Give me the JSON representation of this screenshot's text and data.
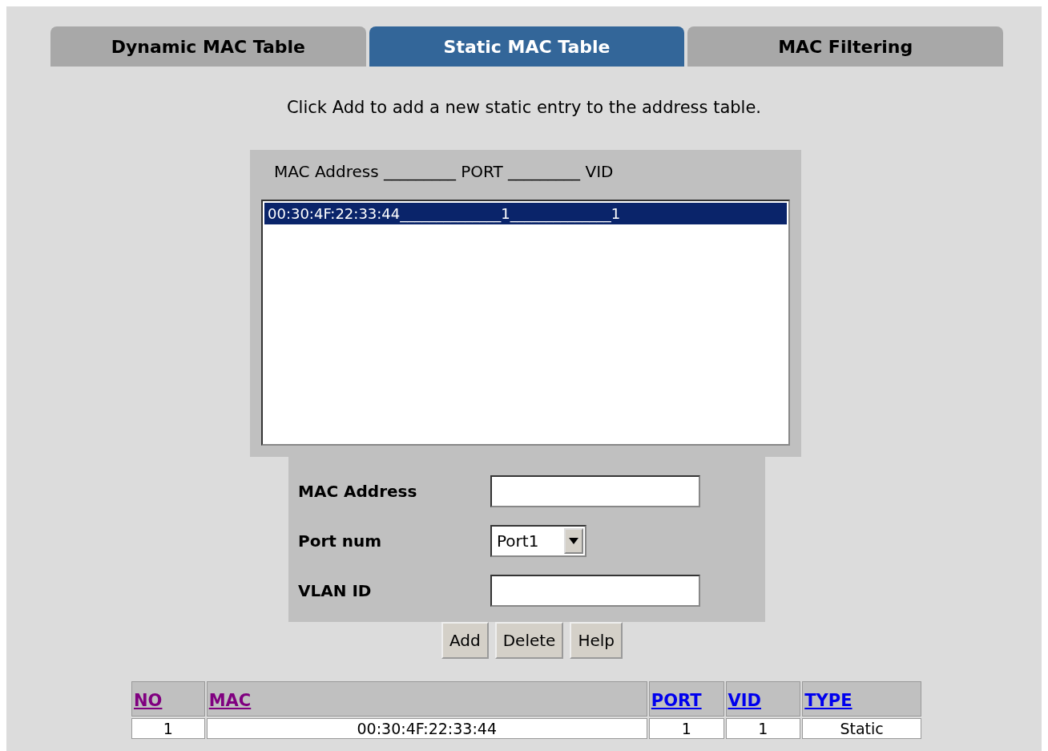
{
  "tabs": [
    {
      "label": "Dynamic MAC Table",
      "selected": false
    },
    {
      "label": "Static MAC Table",
      "selected": true
    },
    {
      "label": "MAC Filtering",
      "selected": false
    }
  ],
  "instruction": "Click Add to add a new static entry to the address table.",
  "static_list": {
    "header": "MAC Address _________ PORT _________ VID",
    "entries": [
      {
        "text": "00:30:4F:22:33:44______________1______________1",
        "selected": true
      }
    ]
  },
  "form": {
    "fields": [
      {
        "kind": "text",
        "label": "MAC Address"
      },
      {
        "kind": "select",
        "label": "Port num",
        "value": "Port1"
      },
      {
        "kind": "text",
        "label": "VLAN ID"
      }
    ],
    "buttons": [
      "Add",
      "Delete",
      "Help"
    ]
  },
  "table": {
    "columns": [
      {
        "label": "NO",
        "visited": true
      },
      {
        "label": "MAC",
        "visited": true
      },
      {
        "label": "PORT",
        "visited": false
      },
      {
        "label": "VID",
        "visited": false
      },
      {
        "label": "TYPE",
        "visited": false
      }
    ],
    "rows": [
      [
        "1",
        "00:30:4F:22:33:44",
        "1",
        "1",
        "Static"
      ]
    ]
  }
}
